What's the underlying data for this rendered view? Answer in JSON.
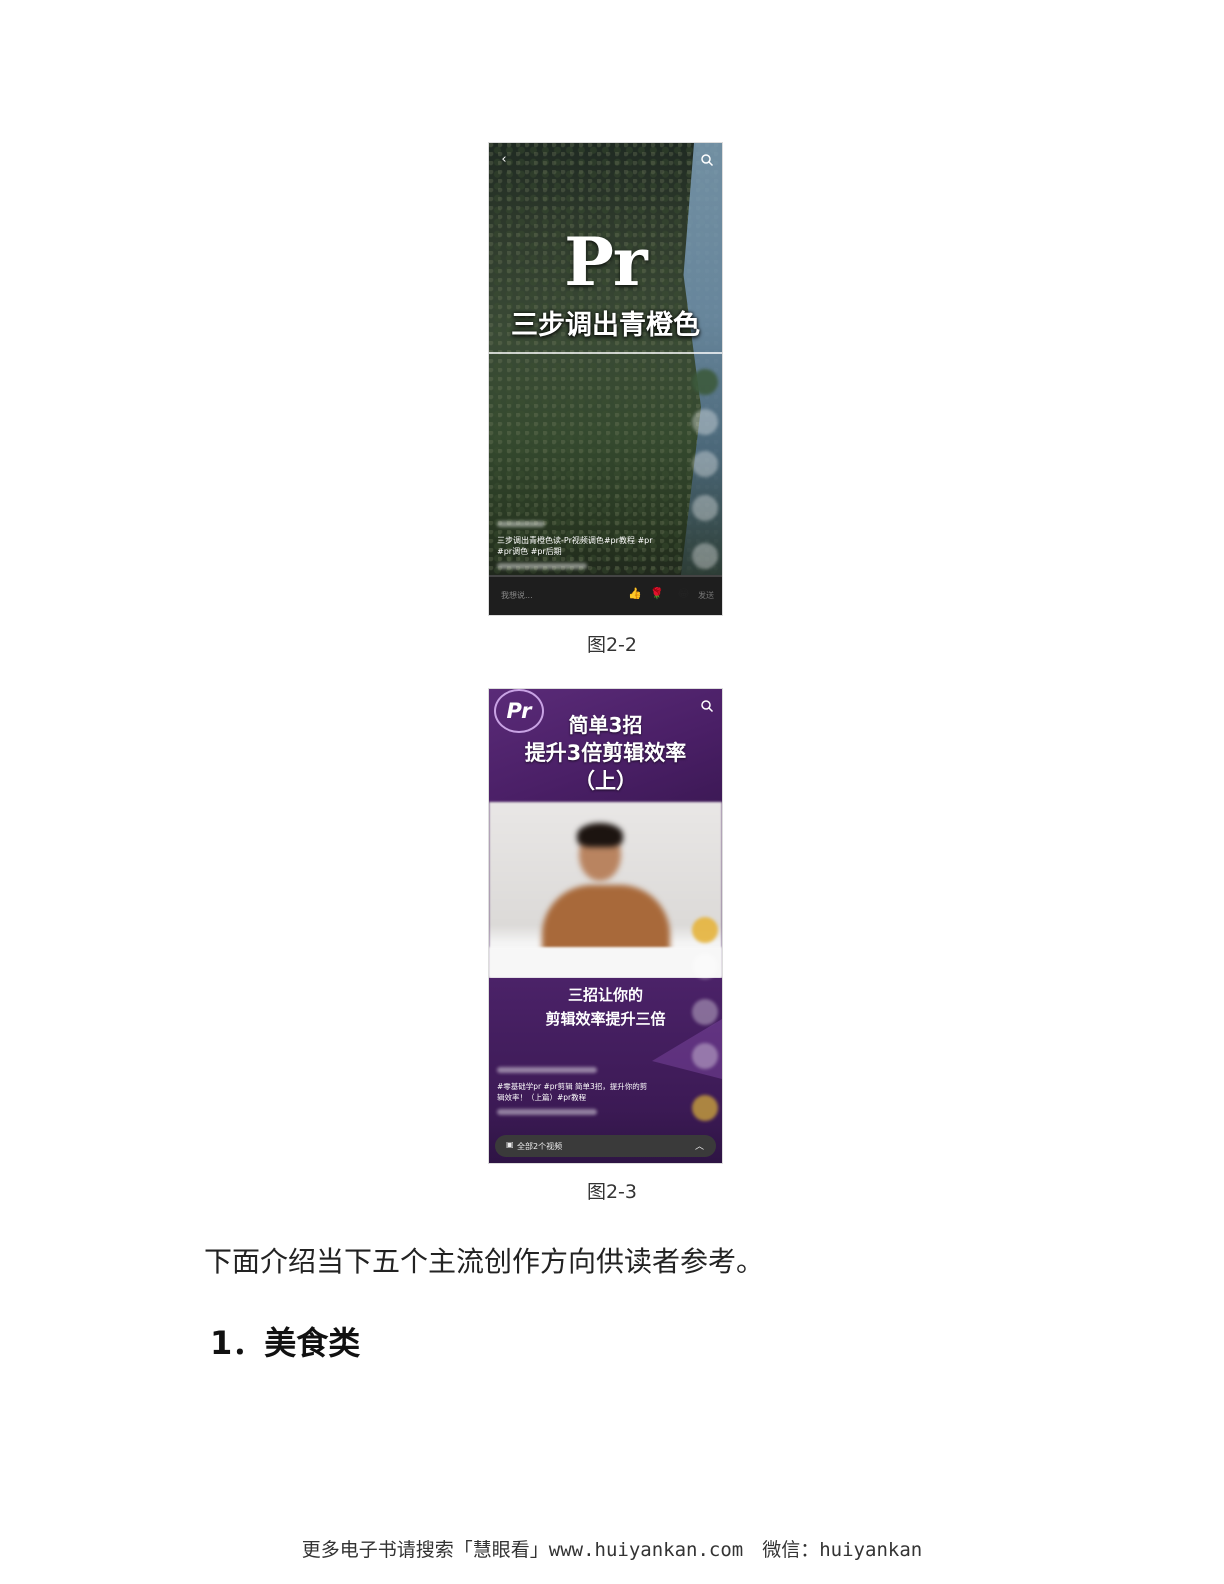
{
  "figure1": {
    "title_big": "Pr",
    "title_sub": "三步调出青橙色",
    "caption_line1": "三步调出青橙色读-Pr视频调色#pr教程 #pr",
    "caption_line2": "#pr调色 #pr后期",
    "comment_placeholder": "我想说...",
    "send_label": "发送",
    "label": "图2-2"
  },
  "figure2": {
    "logo_text": "Pr",
    "title_line1": "简单3招",
    "title_line2": "提升3倍剪辑效率",
    "title_line3": "（上）",
    "mid_line1": "三招让你的",
    "mid_line2": "剪辑效率提升三倍",
    "caption_line1": "#零基础学pr #pr剪辑 简单3招，提升你的剪",
    "caption_line2": "辑效率！（上篇）#pr教程",
    "collection_label": "全部2个视频",
    "label": "图2-3"
  },
  "body": {
    "paragraph": "下面介绍当下五个主流创作方向供读者参考。",
    "heading": "1．美食类"
  },
  "footer": {
    "text": "更多电子书请搜索「慧眼看」www.huiyankan.com　微信：huiyankan"
  }
}
